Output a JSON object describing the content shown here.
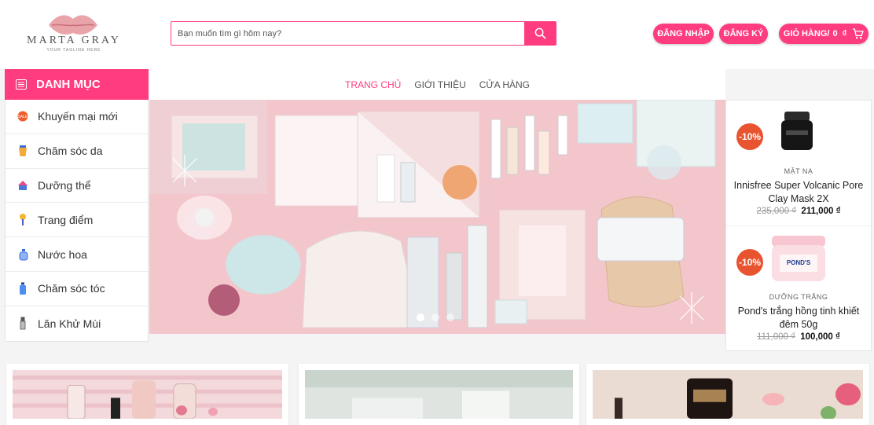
{
  "logo": {
    "brand": "MARTA GRAY",
    "tagline": "YOUR TAGLINE HERE"
  },
  "search": {
    "placeholder": "Bạn muốn tìm gì hôm nay?",
    "value": ""
  },
  "account": {
    "login_label": "ĐĂNG NHẬP",
    "register_label": "ĐĂNG KÝ"
  },
  "cart": {
    "label": "GIỎ HÀNG/",
    "amount": "0",
    "currency": "₫"
  },
  "categories": {
    "title": "DANH MỤC",
    "items": [
      {
        "label": "Khuyến mại mới",
        "icon": "sale-icon"
      },
      {
        "label": "Chăm sóc da",
        "icon": "skincare-icon"
      },
      {
        "label": "Dưỡng thể",
        "icon": "body-lotion-icon"
      },
      {
        "label": "Trang điểm",
        "icon": "makeup-brush-icon"
      },
      {
        "label": "Nước hoa",
        "icon": "perfume-icon"
      },
      {
        "label": "Chăm sóc tóc",
        "icon": "hair-care-icon"
      },
      {
        "label": "Lăn Khử Mùi",
        "icon": "deodorant-icon"
      }
    ]
  },
  "nav": {
    "items": [
      "TRANG CHỦ",
      "GIỚI THIỆU",
      "CỬA HÀNG"
    ],
    "active_index": 0
  },
  "slider": {
    "slide_count": 3,
    "active_slide": 1
  },
  "side_products": [
    {
      "discount": "-10%",
      "category": "MẶT NẠ",
      "name": "Innisfree Super Volcanic Pore Clay Mask 2X",
      "old_price": "235,000",
      "new_price": "211,000",
      "currency": "₫"
    },
    {
      "discount": "-10%",
      "category": "DƯỠNG TRẮNG",
      "name": "Pond's trắng hồng tinh khiết đêm 50g",
      "old_price": "111,000",
      "new_price": "100,000",
      "currency": "₫"
    }
  ],
  "colors": {
    "accent": "#ff3c80",
    "discount_badge": "#e8542f",
    "banner_bg": "#f4c9cf"
  }
}
